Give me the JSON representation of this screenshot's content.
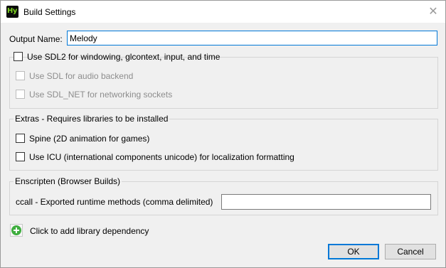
{
  "window": {
    "title": "Build Settings",
    "icon_text": "Hy",
    "close_glyph": "✕"
  },
  "output_name": {
    "label": "Output Name:",
    "value": "Melody"
  },
  "sdl2_group": {
    "checkbox_label": "Use SDL2 for windowing, glcontext, input, and time",
    "checked": false,
    "options": [
      {
        "label": "Use SDL for audio backend",
        "checked": false,
        "enabled": false
      },
      {
        "label": "Use SDL_NET for networking sockets",
        "checked": false,
        "enabled": false
      }
    ]
  },
  "extras_group": {
    "title": "Extras - Requires libraries to be installed",
    "options": [
      {
        "label": "Spine (2D animation for games)",
        "checked": false
      },
      {
        "label": "Use ICU (international components unicode) for localization formatting",
        "checked": false
      }
    ]
  },
  "emscripten_group": {
    "title": "Enscripten (Browser Builds)",
    "ccall_label": "ccall - Exported runtime methods (comma delimited)",
    "ccall_value": ""
  },
  "add_dependency": {
    "label": "Click to add library dependency",
    "icon": "plus-circle-icon",
    "icon_color": "#3fae3f"
  },
  "buttons": {
    "ok": "OK",
    "cancel": "Cancel"
  },
  "colors": {
    "accent": "#0078d7",
    "disabled_text": "#8d8d8d",
    "window_bg": "#f0f0f0"
  }
}
